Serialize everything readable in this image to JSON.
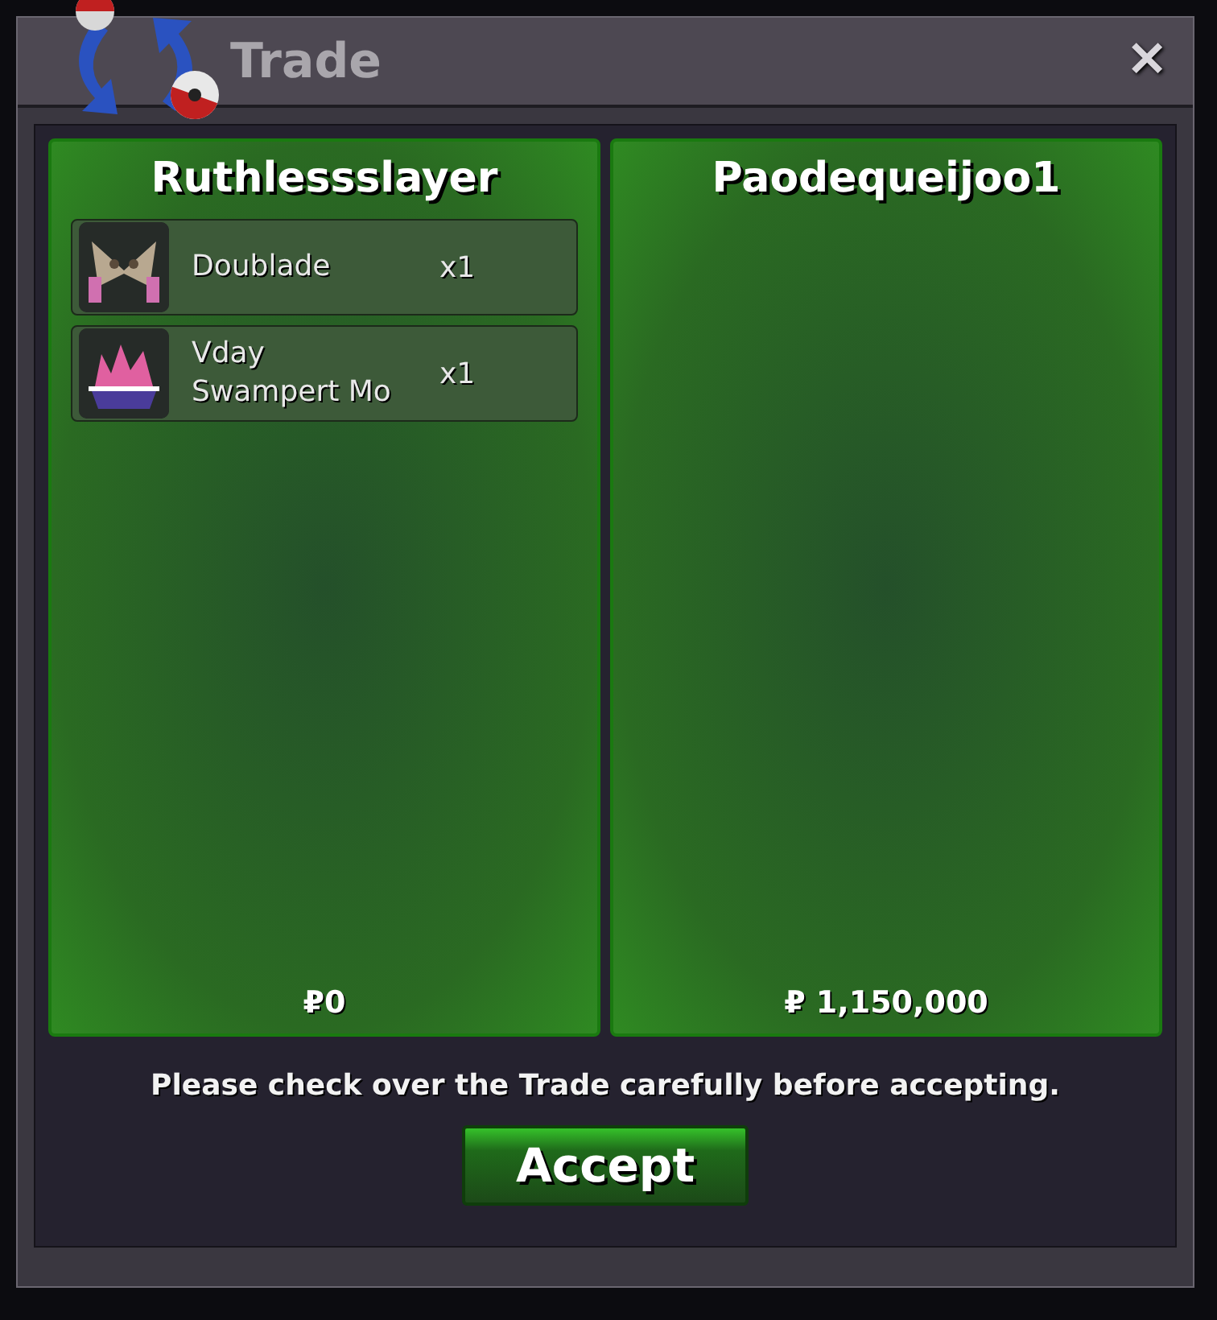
{
  "window": {
    "title": "Trade",
    "close": "✕"
  },
  "offers": [
    {
      "player": "Ruthlessslayer",
      "money": "₽0",
      "items": [
        {
          "kind": "blades",
          "name": "Doublade",
          "quantity": "x1"
        },
        {
          "kind": "coral",
          "name": "Vday Swampert Mo",
          "quantity": "x1"
        }
      ]
    },
    {
      "player": "Paodequeijoo1",
      "money": "₽ 1,150,000"
    }
  ],
  "notice": "Please check over the Trade carefully before accepting.",
  "accept_button": "Accept"
}
